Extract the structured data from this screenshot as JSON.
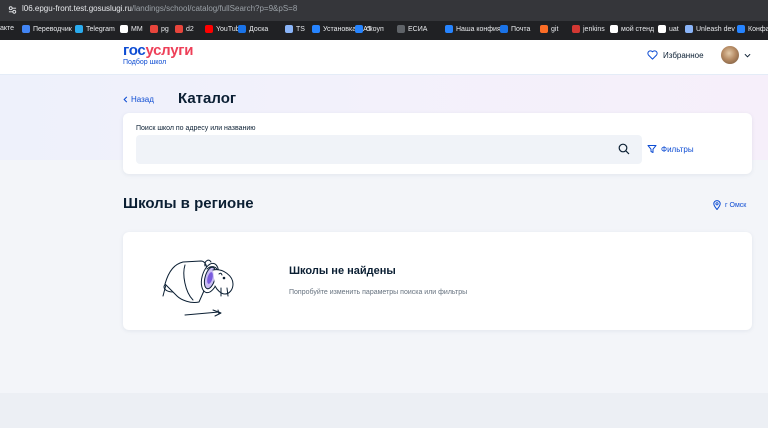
{
  "browser": {
    "url_host": "l06.epgu-front.test.gosuslugi.ru",
    "url_path": "/landings/school/catalog/fullSearch?p=9&pS=8",
    "bookmarks": [
      {
        "label": "акте",
        "color": "#8ab4f8"
      },
      {
        "label": "Переводчик",
        "color": "#4285f4"
      },
      {
        "label": "Telegram",
        "color": "#2aabee"
      },
      {
        "label": "MM",
        "color": "#ffffff"
      },
      {
        "label": "pg",
        "color": "#e8453c"
      },
      {
        "label": "d2",
        "color": "#e8453c"
      },
      {
        "label": "YouTube",
        "color": "#ff0000"
      },
      {
        "label": "Доска",
        "color": "#1a73e8"
      },
      {
        "label": "TS",
        "color": "#8ab4f8"
      },
      {
        "label": "Установка UAT",
        "color": "#2684ff"
      },
      {
        "label": "скоуп",
        "color": "#2684ff"
      },
      {
        "label": "ЕСИА",
        "color": "#5f6368"
      },
      {
        "label": "Наша конфия",
        "color": "#2684ff"
      },
      {
        "label": "Почта",
        "color": "#1a73e8"
      },
      {
        "label": "git",
        "color": "#fc6d26"
      },
      {
        "label": "jenkins",
        "color": "#d33833"
      },
      {
        "label": "мой стенд",
        "color": "#ffffff"
      },
      {
        "label": "uat",
        "color": "#ffffff"
      },
      {
        "label": "Unleash dev",
        "color": "#8ab4f8"
      },
      {
        "label": "Конфа",
        "color": "#2684ff"
      }
    ]
  },
  "header": {
    "logo_part1": "гос",
    "logo_part2": "услуги",
    "logo_subtitle": "Подбор школ",
    "favorites_label": "Избранное"
  },
  "catalog": {
    "back_label": "Назад",
    "title": "Каталог",
    "search_label": "Поиск школ по адресу или названию",
    "search_placeholder": "",
    "filters_label": "Фильтры"
  },
  "schools": {
    "section_title": "Школы в регионе",
    "region_label": "г Омск",
    "empty_title": "Школы не найдены",
    "empty_subtitle": "Попробуйте изменить параметры поиска или фильтры"
  },
  "colors": {
    "brand_blue": "#0d4cd3",
    "brand_red": "#ee3f58",
    "text_dark": "#0b1f33",
    "illustration_accent": "#7a5cdd"
  }
}
